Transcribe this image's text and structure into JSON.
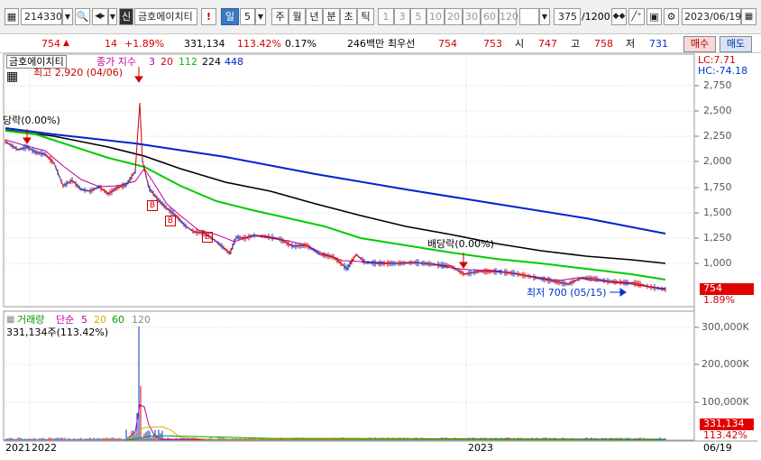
{
  "toolbar": {
    "code": "214330",
    "badge": "신",
    "name": "금호에이치티",
    "excl": "!",
    "period": "일",
    "period_count": "5",
    "p_week": "주",
    "p_month": "월",
    "p_year": "년",
    "p_minute": "분",
    "p_second": "초",
    "p_tick": "틱",
    "intervals": [
      "1",
      "3",
      "5",
      "10",
      "20",
      "30",
      "60",
      "120"
    ],
    "count_value": "375",
    "count_total": "/1200",
    "date": "2023/06/19"
  },
  "quote": {
    "price": "754",
    "change": "14",
    "change_pct": "+1.89%",
    "volume": "331,134",
    "volume_ratio": "113.42%",
    "turnover": "0.17%",
    "amount": "246백만",
    "bid_label": "최우선",
    "ask": "754",
    "bid": "753",
    "open_label": "시",
    "open": "747",
    "high_label": "고",
    "high": "758",
    "low_label": "저",
    "low": "731",
    "buy_label": "매수",
    "sell_label": "매도"
  },
  "chart": {
    "stock_tag": "금호에이치티",
    "ma_label": "종가 지수",
    "ma_periods": [
      "3",
      "20",
      "112",
      "224",
      "448"
    ],
    "high_note": "최고 2,920 (04/06)",
    "low_note": "최저 700 (05/15)",
    "ex_div_left": "당락(0.00%)",
    "ex_div_right": "배당락(0.00%)",
    "lc": "LC:7.71",
    "hc": "HC:-74.18",
    "price_ticks": [
      "2,750",
      "2,500",
      "2,250",
      "2,000",
      "1,750",
      "1,500",
      "1,250",
      "1,000"
    ],
    "price_tag": "754",
    "price_pct": "1.89%",
    "vol_title": "거래량",
    "vol_ma_label": "단순",
    "vol_ma_periods": [
      "5",
      "20",
      "60",
      "120"
    ],
    "vol_value": "331,134주(113.42%)",
    "vol_ticks": [
      "300,000K",
      "200,000K",
      "100,000K"
    ],
    "vol_tag": "331,134",
    "vol_pct": "113.42%",
    "x_labels": [
      "2021",
      "2022",
      "2023"
    ],
    "x_end": "06/19",
    "marker": "B",
    "colors": {
      "ma3": "#d00000",
      "ma20": "#c0009a",
      "ma112": "#00cc00",
      "ma224": "#000000",
      "ma448": "#0022cc",
      "up": "#d00000",
      "down": "#0033cc"
    }
  }
}
